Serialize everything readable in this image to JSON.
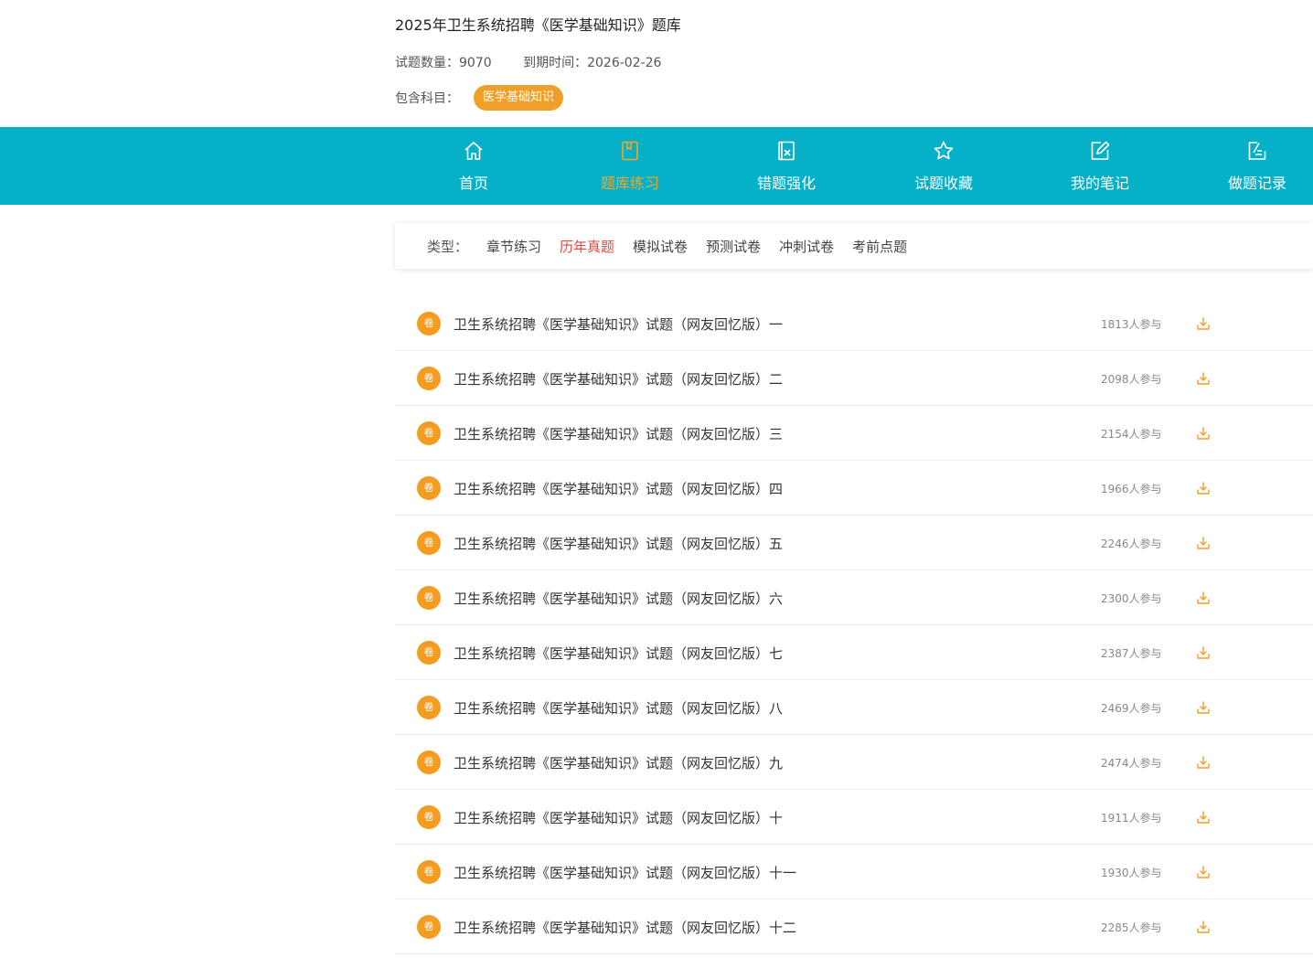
{
  "header": {
    "title": "2025年卫生系统招聘《医学基础知识》题库",
    "question_count_label": "试题数量：9070",
    "expiry_label": "到期时间：2026-02-26",
    "subjects_label": "包含科目：",
    "subject_chip": "医学基础知识"
  },
  "nav": {
    "items": [
      {
        "label": "首页",
        "icon": "home-icon"
      },
      {
        "label": "题库练习",
        "icon": "book-icon",
        "active": true
      },
      {
        "label": "错题强化",
        "icon": "wrong-question-icon"
      },
      {
        "label": "试题收藏",
        "icon": "star-icon"
      },
      {
        "label": "我的笔记",
        "icon": "edit-note-icon"
      },
      {
        "label": "做题记录",
        "icon": "record-icon"
      }
    ],
    "bg_color": "#06b0c6",
    "active_color": "#f5a623"
  },
  "filter": {
    "label": "类型：",
    "items": [
      {
        "label": "章节练习"
      },
      {
        "label": "历年真题",
        "active": true
      },
      {
        "label": "模拟试卷"
      },
      {
        "label": "预测试卷"
      },
      {
        "label": "冲刺试卷"
      },
      {
        "label": "考前点题"
      }
    ],
    "active_color": "#e8463b"
  },
  "papers": {
    "badge": "卷",
    "badge_color": "#f39c20",
    "items": [
      {
        "name": "卫生系统招聘《医学基础知识》试题（网友回忆版）一",
        "count": "1813人参与"
      },
      {
        "name": "卫生系统招聘《医学基础知识》试题（网友回忆版）二",
        "count": "2098人参与"
      },
      {
        "name": "卫生系统招聘《医学基础知识》试题（网友回忆版）三",
        "count": "2154人参与"
      },
      {
        "name": "卫生系统招聘《医学基础知识》试题（网友回忆版）四",
        "count": "1966人参与"
      },
      {
        "name": "卫生系统招聘《医学基础知识》试题（网友回忆版）五",
        "count": "2246人参与"
      },
      {
        "name": "卫生系统招聘《医学基础知识》试题（网友回忆版）六",
        "count": "2300人参与"
      },
      {
        "name": "卫生系统招聘《医学基础知识》试题（网友回忆版）七",
        "count": "2387人参与"
      },
      {
        "name": "卫生系统招聘《医学基础知识》试题（网友回忆版）八",
        "count": "2469人参与"
      },
      {
        "name": "卫生系统招聘《医学基础知识》试题（网友回忆版）九",
        "count": "2474人参与"
      },
      {
        "name": "卫生系统招聘《医学基础知识》试题（网友回忆版）十",
        "count": "1911人参与"
      },
      {
        "name": "卫生系统招聘《医学基础知识》试题（网友回忆版）十一",
        "count": "1930人参与"
      },
      {
        "name": "卫生系统招聘《医学基础知识》试题（网友回忆版）十二",
        "count": "2285人参与"
      }
    ]
  }
}
